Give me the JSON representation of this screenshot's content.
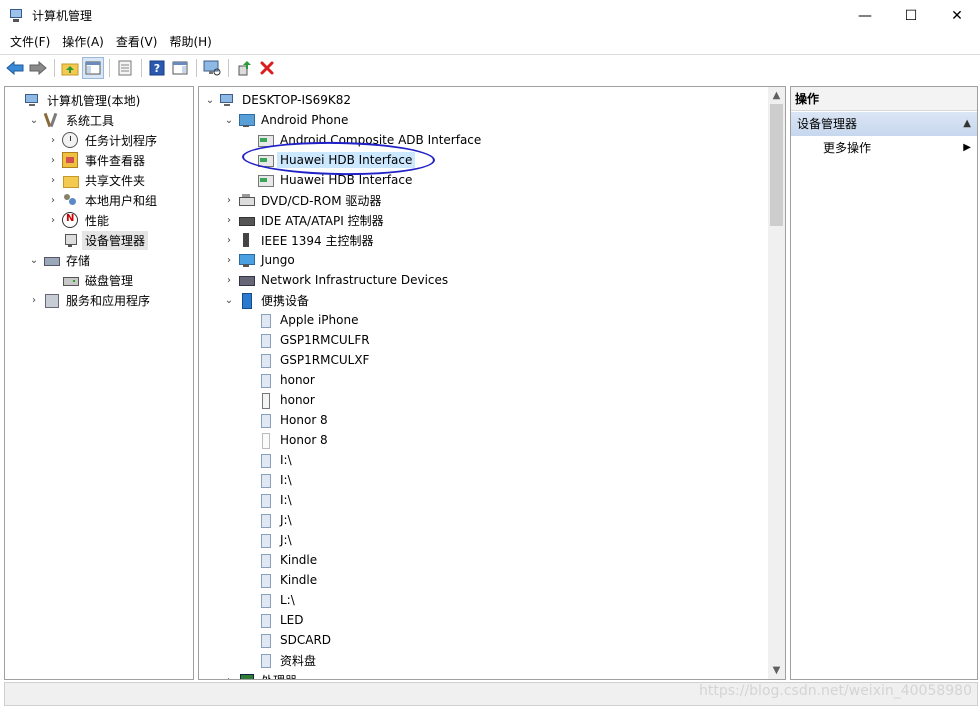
{
  "window": {
    "title": "计算机管理",
    "minimize": "—",
    "maximize": "☐",
    "close": "✕"
  },
  "menu": [
    "文件(F)",
    "操作(A)",
    "查看(V)",
    "帮助(H)"
  ],
  "left_tree": [
    {
      "label": "计算机管理(本地)",
      "icon": "computer-icon",
      "depth": 0,
      "chevron": ""
    },
    {
      "label": "系统工具",
      "icon": "tools-icon",
      "depth": 1,
      "chevron": "⌄"
    },
    {
      "label": "任务计划程序",
      "icon": "clock-icon",
      "depth": 2,
      "chevron": "›"
    },
    {
      "label": "事件查看器",
      "icon": "event-log-icon",
      "depth": 2,
      "chevron": "›"
    },
    {
      "label": "共享文件夹",
      "icon": "folder-icon",
      "depth": 2,
      "chevron": "›"
    },
    {
      "label": "本地用户和组",
      "icon": "users-icon",
      "depth": 2,
      "chevron": "›"
    },
    {
      "label": "性能",
      "icon": "performance-icon",
      "depth": 2,
      "chevron": "›"
    },
    {
      "label": "设备管理器",
      "icon": "device-manager-icon",
      "depth": 2,
      "chevron": "",
      "selected": true
    },
    {
      "label": "存储",
      "icon": "storage-icon",
      "depth": 1,
      "chevron": "⌄"
    },
    {
      "label": "磁盘管理",
      "icon": "disk-icon",
      "depth": 2,
      "chevron": ""
    },
    {
      "label": "服务和应用程序",
      "icon": "services-icon",
      "depth": 1,
      "chevron": "›"
    }
  ],
  "device_tree": [
    {
      "label": "DESKTOP-IS69K82",
      "icon": "computer-icon",
      "depth": 0,
      "chevron": "⌄"
    },
    {
      "label": "Android Phone",
      "icon": "android-phone-icon",
      "depth": 1,
      "chevron": "⌄"
    },
    {
      "label": "Android Composite ADB Interface",
      "icon": "adb-interface-icon",
      "depth": 2,
      "chevron": ""
    },
    {
      "label": "Huawei HDB Interface",
      "icon": "adb-interface-icon",
      "depth": 2,
      "chevron": "",
      "selected": true
    },
    {
      "label": "Huawei HDB Interface",
      "icon": "adb-interface-icon",
      "depth": 2,
      "chevron": ""
    },
    {
      "label": "DVD/CD-ROM 驱动器",
      "icon": "dvd-drive-icon",
      "depth": 1,
      "chevron": "›"
    },
    {
      "label": "IDE ATA/ATAPI 控制器",
      "icon": "ide-controller-icon",
      "depth": 1,
      "chevron": "›"
    },
    {
      "label": "IEEE 1394 主控制器",
      "icon": "ieee1394-icon",
      "depth": 1,
      "chevron": "›"
    },
    {
      "label": "Jungo",
      "icon": "jungo-icon",
      "depth": 1,
      "chevron": "›"
    },
    {
      "label": "Network Infrastructure Devices",
      "icon": "network-device-icon",
      "depth": 1,
      "chevron": "›"
    },
    {
      "label": "便携设备",
      "icon": "portable-devices-icon",
      "depth": 1,
      "chevron": "⌄"
    },
    {
      "label": "Apple iPhone",
      "icon": "portable-device-icon",
      "depth": 2,
      "chevron": ""
    },
    {
      "label": "GSP1RMCULFR",
      "icon": "portable-device-icon",
      "depth": 2,
      "chevron": ""
    },
    {
      "label": "GSP1RMCULXF",
      "icon": "portable-device-icon",
      "depth": 2,
      "chevron": ""
    },
    {
      "label": "honor",
      "icon": "portable-device-icon",
      "depth": 2,
      "chevron": ""
    },
    {
      "label": "honor",
      "icon": "phone-icon",
      "depth": 2,
      "chevron": ""
    },
    {
      "label": "Honor 8",
      "icon": "portable-device-icon",
      "depth": 2,
      "chevron": ""
    },
    {
      "label": "Honor 8",
      "icon": "phone-light-icon",
      "depth": 2,
      "chevron": ""
    },
    {
      "label": "I:\\",
      "icon": "portable-device-icon",
      "depth": 2,
      "chevron": ""
    },
    {
      "label": "I:\\",
      "icon": "portable-device-icon",
      "depth": 2,
      "chevron": ""
    },
    {
      "label": "I:\\",
      "icon": "portable-device-icon",
      "depth": 2,
      "chevron": ""
    },
    {
      "label": "J:\\",
      "icon": "portable-device-icon",
      "depth": 2,
      "chevron": ""
    },
    {
      "label": "J:\\",
      "icon": "portable-device-icon",
      "depth": 2,
      "chevron": ""
    },
    {
      "label": "Kindle",
      "icon": "portable-device-icon",
      "depth": 2,
      "chevron": ""
    },
    {
      "label": "Kindle",
      "icon": "portable-device-icon",
      "depth": 2,
      "chevron": ""
    },
    {
      "label": "L:\\",
      "icon": "portable-device-icon",
      "depth": 2,
      "chevron": ""
    },
    {
      "label": "LED",
      "icon": "portable-device-icon",
      "depth": 2,
      "chevron": ""
    },
    {
      "label": "SDCARD",
      "icon": "portable-device-icon",
      "depth": 2,
      "chevron": ""
    },
    {
      "label": "资料盘",
      "icon": "portable-device-icon",
      "depth": 2,
      "chevron": ""
    },
    {
      "label": "处理器",
      "icon": "cpu-icon",
      "depth": 1,
      "chevron": "›"
    }
  ],
  "actions": {
    "header": "操作",
    "section": "设备管理器",
    "more": "更多操作"
  },
  "watermark": "https://blog.csdn.net/weixin_40058980",
  "colors": {
    "selection_blue": "#cce8ff",
    "annotation_circle": "#2121c8",
    "delete_red": "#d81e1e"
  }
}
